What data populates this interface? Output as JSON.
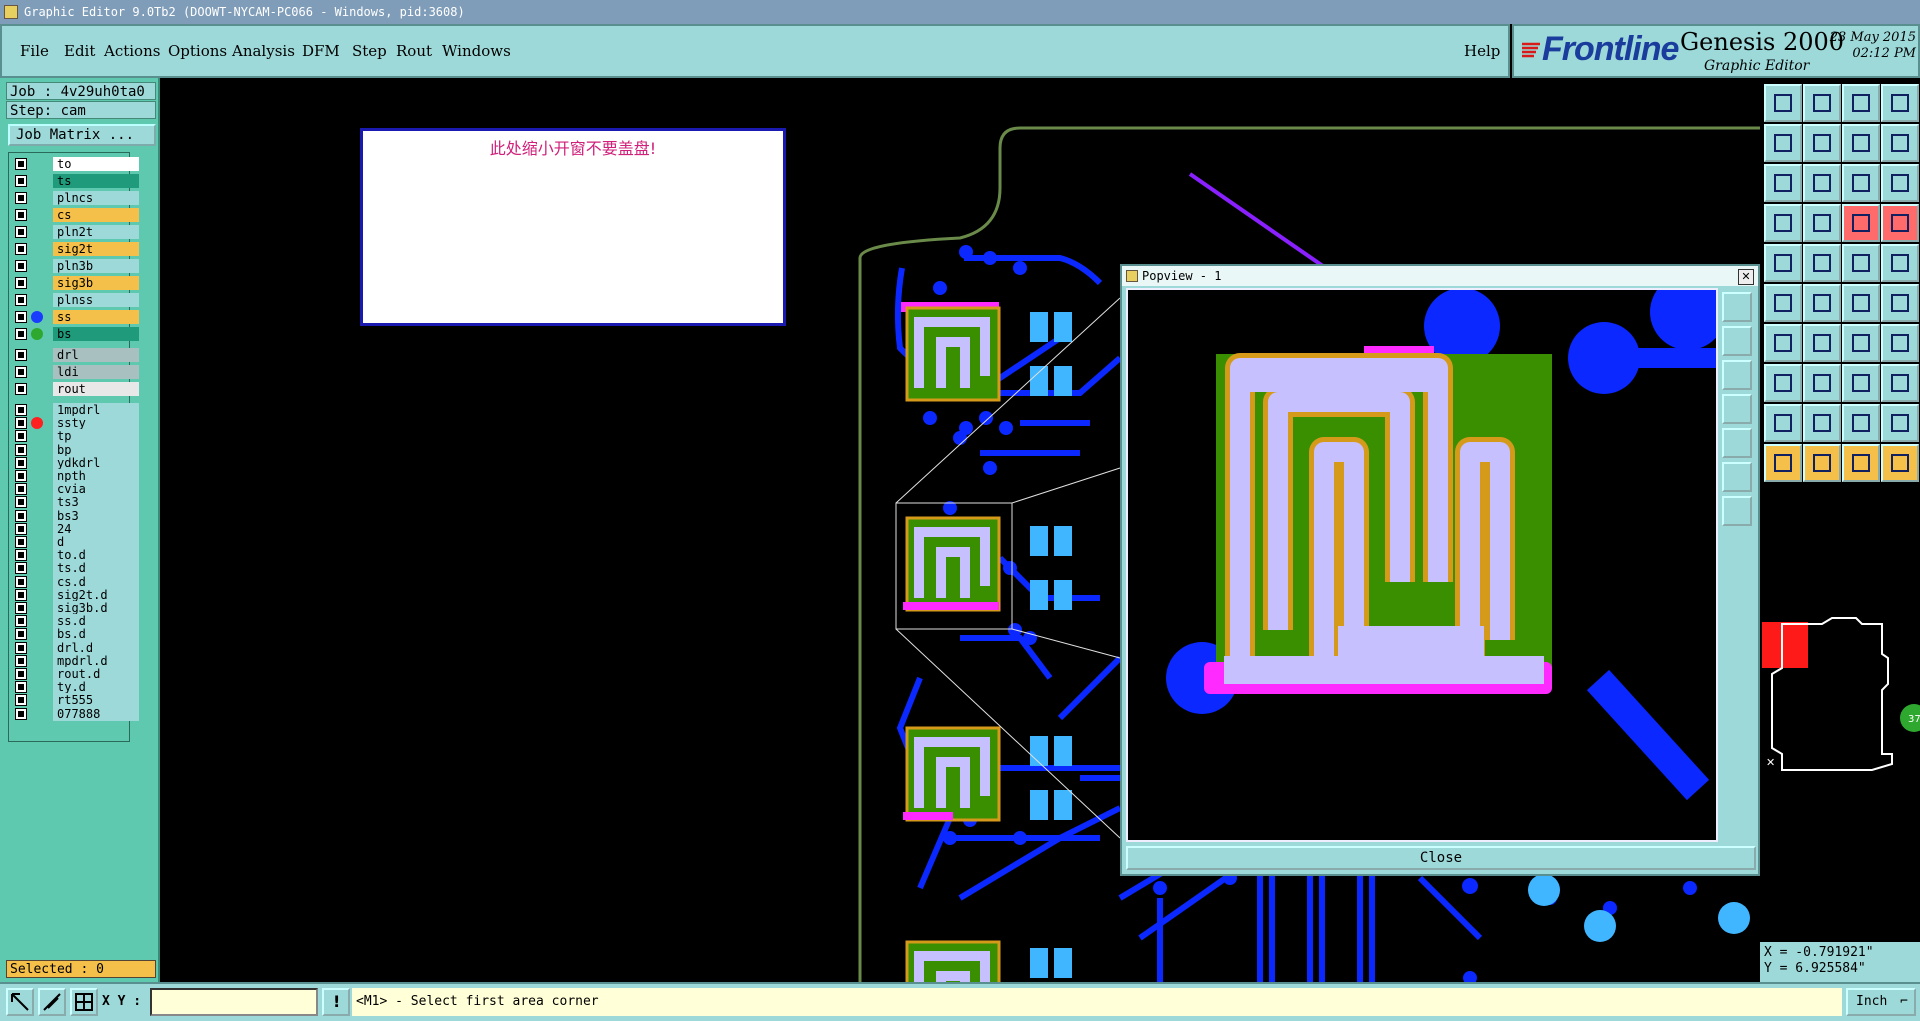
{
  "window": {
    "title": "Graphic Editor 9.0Tb2 (DOOWT-NYCAM-PC066 - Windows, pid:3608)"
  },
  "menu": {
    "items": [
      "File",
      "Edit",
      "Actions",
      "Options",
      "Analysis",
      "DFM",
      "Step",
      "Rout",
      "Windows"
    ],
    "help": "Help"
  },
  "brand": {
    "logo": "Frontline",
    "product": "Genesis 2000",
    "subtitle": "Graphic Editor",
    "date": "23 May 2015",
    "time": "02:12 PM"
  },
  "panel": {
    "job": "Job : 4v29uh0ta0",
    "step": "Step: cam",
    "job_matrix": "Job Matrix ...",
    "selected": "Selected : 0"
  },
  "layers": [
    {
      "name": "to",
      "bg": "#ffffff",
      "dot": ""
    },
    {
      "name": "ts",
      "bg": "#1f9a7a",
      "dot": ""
    },
    {
      "name": "plncs",
      "bg": "#9ed9d9",
      "dot": ""
    },
    {
      "name": "cs",
      "bg": "#f5c04a",
      "dot": ""
    },
    {
      "name": "pln2t",
      "bg": "#9ed9d9",
      "dot": ""
    },
    {
      "name": "sig2t",
      "bg": "#f5c04a",
      "dot": ""
    },
    {
      "name": "pln3b",
      "bg": "#9ed9d9",
      "dot": ""
    },
    {
      "name": "sig3b",
      "bg": "#f5c04a",
      "dot": ""
    },
    {
      "name": "plnss",
      "bg": "#9ed9d9",
      "dot": ""
    },
    {
      "name": "ss",
      "bg": "#f5c04a",
      "dot": "#1a3cff"
    },
    {
      "name": "bs",
      "bg": "#1f9a7a",
      "dot": "#2fa82f"
    },
    {
      "name": "drl",
      "bg": "#a9c0c0",
      "dot": ""
    },
    {
      "name": "ldi",
      "bg": "#a9c0c0",
      "dot": ""
    },
    {
      "name": "rout",
      "bg": "#e8e8e8",
      "dot": ""
    },
    {
      "name": "1mpdrl",
      "bg": "#9ed9d9",
      "dot": ""
    },
    {
      "name": "ssty",
      "bg": "#9ed9d9",
      "dot": "#ff2020"
    },
    {
      "name": "tp",
      "bg": "#9ed9d9",
      "dot": ""
    },
    {
      "name": "bp",
      "bg": "#9ed9d9",
      "dot": ""
    },
    {
      "name": "ydkdrl",
      "bg": "#9ed9d9",
      "dot": ""
    },
    {
      "name": "npth",
      "bg": "#9ed9d9",
      "dot": ""
    },
    {
      "name": "cvia",
      "bg": "#9ed9d9",
      "dot": ""
    },
    {
      "name": "ts3",
      "bg": "#9ed9d9",
      "dot": ""
    },
    {
      "name": "bs3",
      "bg": "#9ed9d9",
      "dot": ""
    },
    {
      "name": "24",
      "bg": "#9ed9d9",
      "dot": ""
    },
    {
      "name": "d",
      "bg": "#9ed9d9",
      "dot": ""
    },
    {
      "name": "to.d",
      "bg": "#9ed9d9",
      "dot": ""
    },
    {
      "name": "ts.d",
      "bg": "#9ed9d9",
      "dot": ""
    },
    {
      "name": "cs.d",
      "bg": "#9ed9d9",
      "dot": ""
    },
    {
      "name": "sig2t.d",
      "bg": "#9ed9d9",
      "dot": ""
    },
    {
      "name": "sig3b.d",
      "bg": "#9ed9d9",
      "dot": ""
    },
    {
      "name": "ss.d",
      "bg": "#9ed9d9",
      "dot": ""
    },
    {
      "name": "bs.d",
      "bg": "#9ed9d9",
      "dot": ""
    },
    {
      "name": "drl.d",
      "bg": "#9ed9d9",
      "dot": ""
    },
    {
      "name": "mpdrl.d",
      "bg": "#9ed9d9",
      "dot": ""
    },
    {
      "name": "rout.d",
      "bg": "#9ed9d9",
      "dot": ""
    },
    {
      "name": "ty.d",
      "bg": "#9ed9d9",
      "dot": ""
    },
    {
      "name": "rt555",
      "bg": "#9ed9d9",
      "dot": ""
    },
    {
      "name": "077888",
      "bg": "#9ed9d9",
      "dot": ""
    }
  ],
  "note": {
    "text": "此处缩小开窗不要盖盘!"
  },
  "popview": {
    "title": "Popview - 1",
    "close_label": "Close"
  },
  "overview": {
    "badge": "37"
  },
  "coords": {
    "x": "X = -0.791921\"",
    "y": "Y = 6.925584\""
  },
  "status": {
    "xy_label": "X Y :",
    "xy_value": "",
    "prompt": "<M1> - Select first area corner",
    "units": "Inch"
  },
  "colors": {
    "copper_blue": "#0a28ff",
    "pad_cyan": "#3fb6ff",
    "solder_green": "#3a8f00",
    "paste_lavender": "#c6c0ff",
    "outline_gold": "#d69a1a",
    "magenta": "#ff2aff",
    "arrow_purple": "#8a20ff"
  }
}
